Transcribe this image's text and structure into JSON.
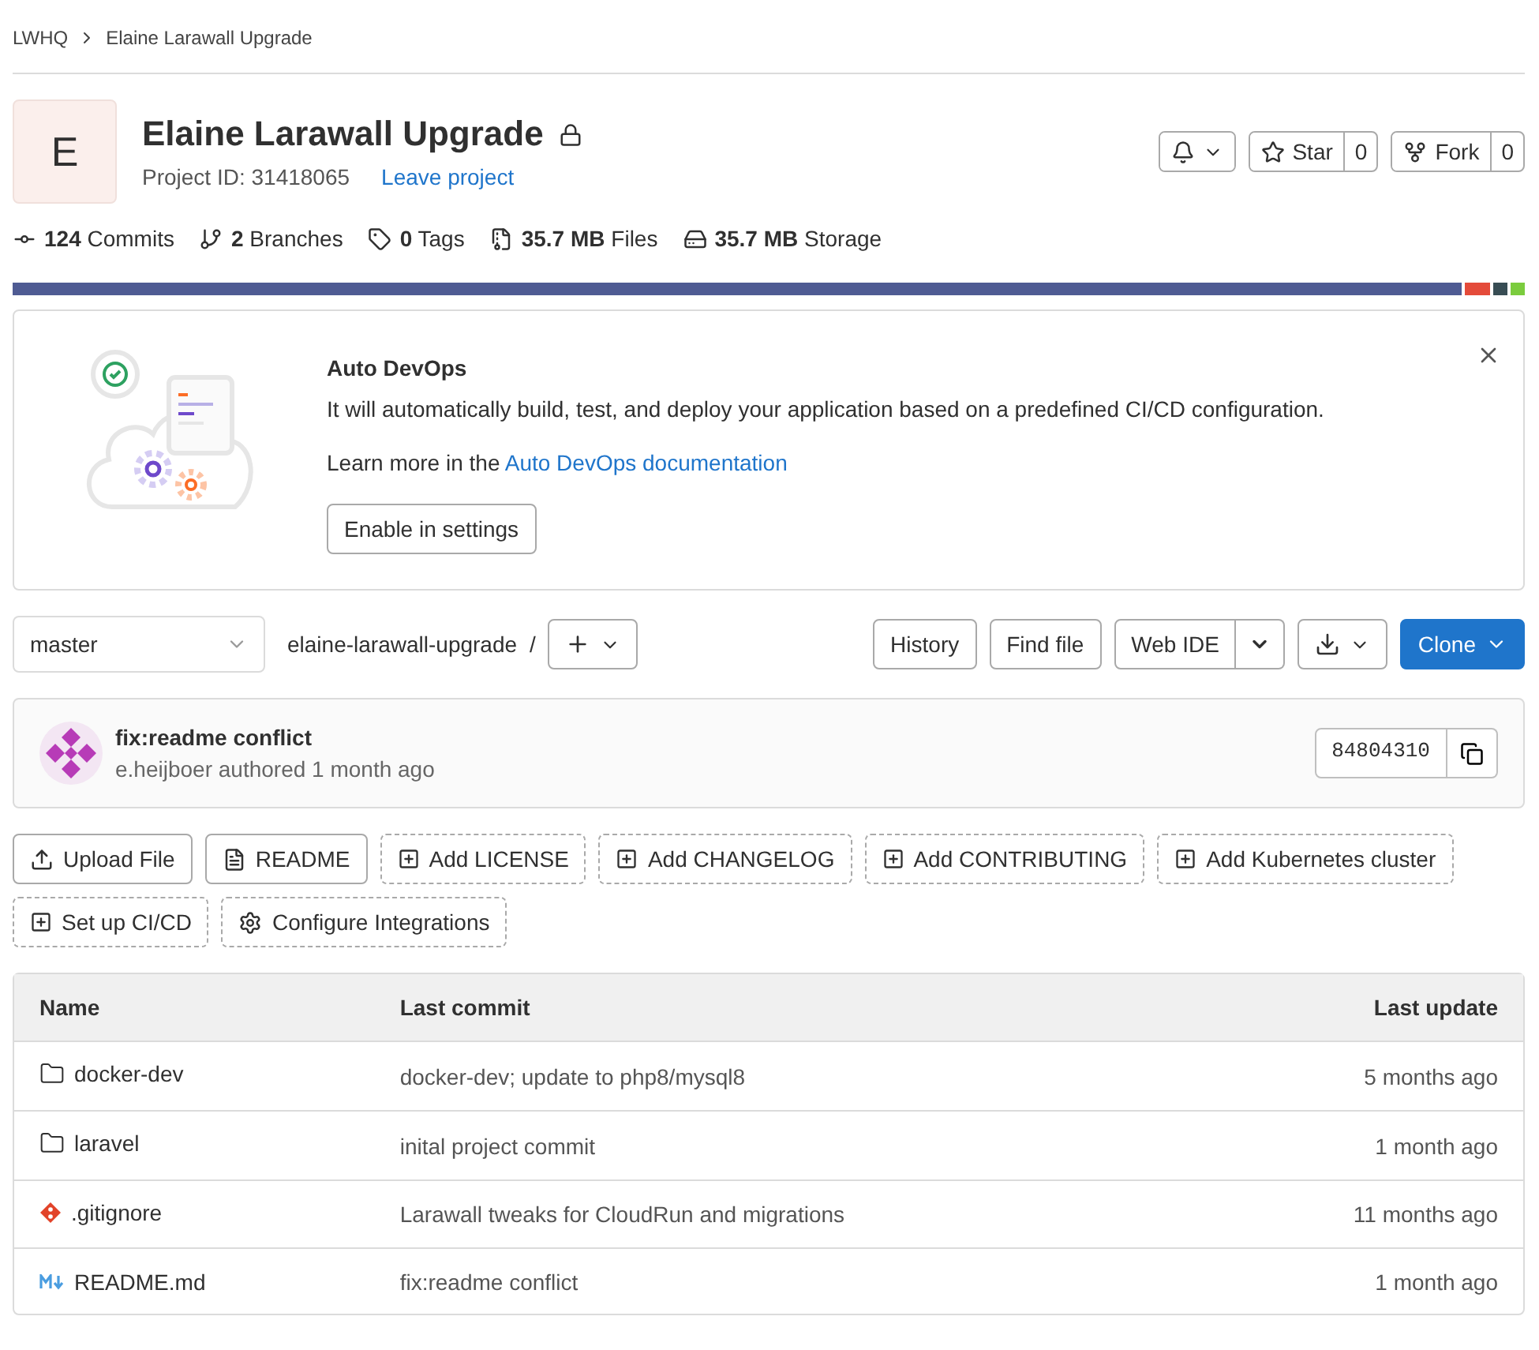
{
  "breadcrumbs": [
    "LWHQ",
    "Elaine Larawall Upgrade"
  ],
  "project": {
    "avatar": "E",
    "name": "Elaine Larawall Upgrade",
    "id_text": "Project ID: 31418065",
    "leave_link": "Leave project",
    "star_label": "Star",
    "star_count": "0",
    "fork_label": "Fork",
    "fork_count": "0"
  },
  "stats": [
    "**124** Commits",
    "**2** Branches",
    "**0** Tags",
    "**35.7 MB** Files",
    "**35.7 MB** Storage"
  ],
  "banner": {
    "title": "Auto DevOps",
    "text": "It will automatically build, test, and deploy your application based on a predefined CI/CD configuration.",
    "learn_prefix": "Learn more in the",
    "learn_link": "Auto DevOps documentation",
    "button": "Enable in settings"
  },
  "repo_bar": {
    "branch": "master",
    "path": "elaine-larawall-upgrade",
    "separator": "/",
    "history": "History",
    "find_file": "Find file",
    "web_ide": "Web IDE",
    "clone": "Clone"
  },
  "last_commit": {
    "title": "fix:readme conflict",
    "author": "e.heijboer authored 1 month ago",
    "sha": "84804310"
  },
  "actions": [
    {
      "kind": "upload",
      "label": "Upload File"
    },
    {
      "kind": "file",
      "label": "README"
    },
    {
      "kind": "add",
      "label": "Add LICENSE"
    },
    {
      "kind": "add",
      "label": "Add CHANGELOG"
    },
    {
      "kind": "add",
      "label": "Add CONTRIBUTING"
    },
    {
      "kind": "add",
      "label": "Add Kubernetes cluster"
    },
    {
      "kind": "add",
      "label": "Set up CI/CD"
    },
    {
      "kind": "settings",
      "label": "Configure Integrations"
    }
  ],
  "table": {
    "columns": [
      "Name",
      "Last commit",
      "Last update"
    ],
    "rows": [
      {
        "kind": "folder",
        "name": "docker-dev",
        "commit": "docker-dev; update to php8/mysql8",
        "updated": "5 months ago"
      },
      {
        "kind": "folder",
        "name": "laravel",
        "commit": "inital project commit",
        "updated": "1 month ago"
      },
      {
        "kind": "git",
        "name": ".gitignore",
        "commit": "Larawall tweaks for CloudRun and migrations",
        "updated": "11 months ago"
      },
      {
        "kind": "markdown",
        "name": "README.md",
        "commit": "fix:readme conflict",
        "updated": "1 month ago"
      }
    ]
  }
}
